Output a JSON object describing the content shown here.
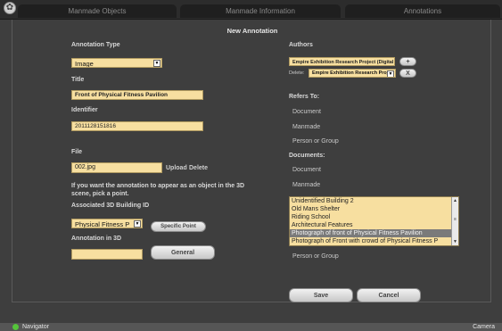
{
  "tabs": [
    "Manmade Objects",
    "Manmade Information",
    "Annotations"
  ],
  "dialog_title": "New Annotation",
  "left": {
    "annotation_type_label": "Annotation Type",
    "annotation_type_value": "Image",
    "title_label": "Title",
    "title_value": "Front of Physical Fitness Pavilion",
    "identifier_label": "Identifier",
    "identifier_value": "2011128151816",
    "file_label": "File",
    "file_value": "002.jpg",
    "upload_label": "Upload",
    "delete_label": "Delete",
    "instructions": "If you want the annotation to appear as an object in the 3D scene, pick a point.",
    "building_label": "Associated 3D Building ID",
    "building_value": "Physical Fitness P",
    "specific_point_label": "Specific Point",
    "annotation3d_label": "Annotation in 3D",
    "annotation3d_value": "",
    "general_label": "General"
  },
  "right": {
    "authors_label": "Authors",
    "author_value": "Empire Exhibition Research Project (Digital Desig",
    "add_label": "+",
    "delete_prefix": "Delete:",
    "delete_select_value": "Empire Exhibition Research Projec",
    "x_label": "X",
    "refers_to_label": "Refers To:",
    "refers_document": "Document",
    "refers_manmade": "Manmade",
    "refers_person": "Person or Group",
    "documents_label": "Documents:",
    "docs_document": "Document",
    "docs_manmade": "Manmade",
    "list_items": [
      "Unidentified Building 2",
      "Old Mans Shelter",
      "Riding School",
      "Architectural Features",
      "Photograph of front of Physical Fitness Pavilion",
      "Photograph of Front with crowd of Physical Fitness P"
    ],
    "docs_person": "Person or Group",
    "save_label": "Save",
    "cancel_label": "Cancel"
  },
  "bottom": {
    "navigator": "Navigator",
    "camera": "Camera"
  },
  "colors": {
    "field": "#f7dfa0",
    "background": "#3e3e3e",
    "selection": "#7a7a7a",
    "navigator_dot": "#55c43a"
  }
}
